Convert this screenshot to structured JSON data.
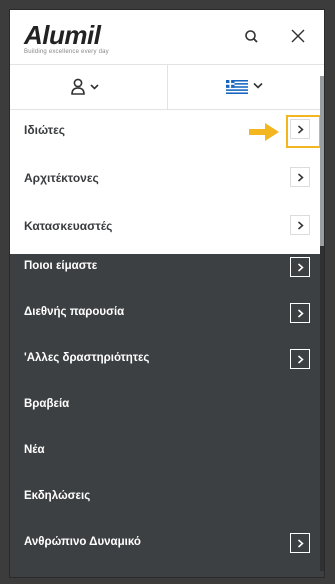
{
  "header": {
    "logo_text": "Alumil",
    "logo_tagline": "Building excellence every day",
    "search_icon": "search-icon",
    "close_icon": "close-icon"
  },
  "subbar": {
    "user_icon": "user-icon",
    "language_flag": "greece-flag-icon"
  },
  "primary_menu": [
    {
      "label": "Ιδιώτες",
      "has_submenu": true,
      "highlighted": true
    },
    {
      "label": "Αρχιτέκτονες",
      "has_submenu": true
    },
    {
      "label": "Κατασκευαστές",
      "has_submenu": true
    }
  ],
  "secondary_menu": [
    {
      "label": "Ποιοι είμαστε",
      "has_submenu": true
    },
    {
      "label": "Διεθνής παρουσία",
      "has_submenu": true
    },
    {
      "label": "'Αλλες δραστηριότητες",
      "has_submenu": true
    },
    {
      "label": "Βραβεία",
      "has_submenu": false
    },
    {
      "label": "Νέα",
      "has_submenu": false
    },
    {
      "label": "Εκδηλώσεις",
      "has_submenu": false
    },
    {
      "label": "Ανθρώπινο Δυναμικό",
      "has_submenu": true
    }
  ],
  "colors": {
    "highlight": "#f3b61f",
    "dark_menu_bg": "#3d4042",
    "flag_blue": "#1565c0"
  }
}
